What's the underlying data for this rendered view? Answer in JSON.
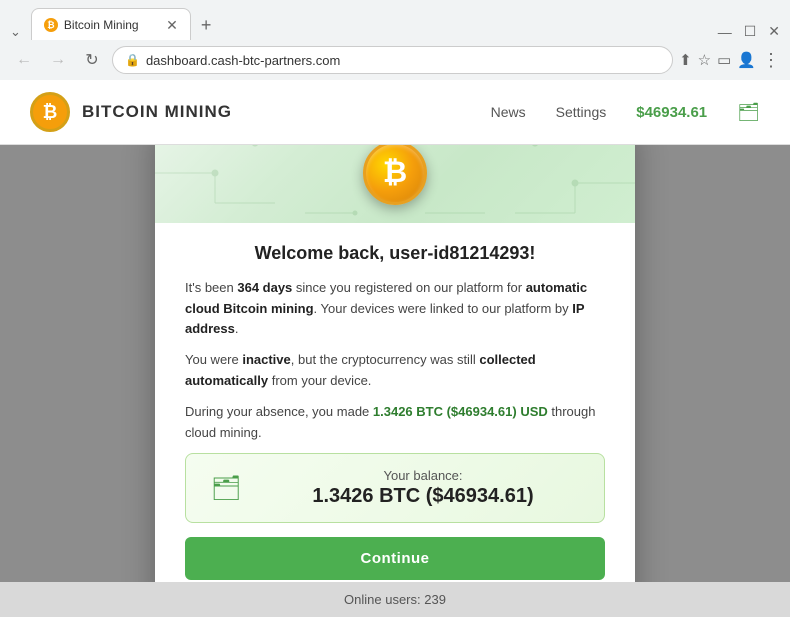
{
  "browser": {
    "tab_title": "Bitcoin Mining",
    "url": "dashboard.cash-btc-partners.com",
    "window_controls": {
      "minimize": "—",
      "maximize": "☐",
      "close": "✕"
    }
  },
  "site": {
    "brand": "BITCOIN MINING",
    "nav": {
      "news": "News",
      "settings": "Settings"
    },
    "balance": "$46934.61",
    "online_label": "Online users:",
    "online_count": "239"
  },
  "modal": {
    "title": "Welcome back, user-id81214293!",
    "paragraph1_start": "It's been ",
    "days_bold": "364 days",
    "paragraph1_mid": " since you registered on our platform for ",
    "auto_bold": "automatic cloud Bitcoin mining",
    "paragraph1_end": ". Your devices were linked to our platform by ",
    "ip_bold": "IP address",
    "paragraph1_dot": ".",
    "paragraph2_start": "You were ",
    "inactive_bold": "inactive",
    "paragraph2_mid": ", but the cryptocurrency was still ",
    "collected_bold": "collected automatically",
    "paragraph2_end": " from your device.",
    "paragraph3_start": "During your absence, you made ",
    "earned_green": "1.3426 BTC ($46934.61) USD",
    "paragraph3_end": " through cloud mining.",
    "balance_label": "Your balance:",
    "balance_amount": "1.3426 BTC ($46934.61)",
    "continue_label": "Continue"
  }
}
